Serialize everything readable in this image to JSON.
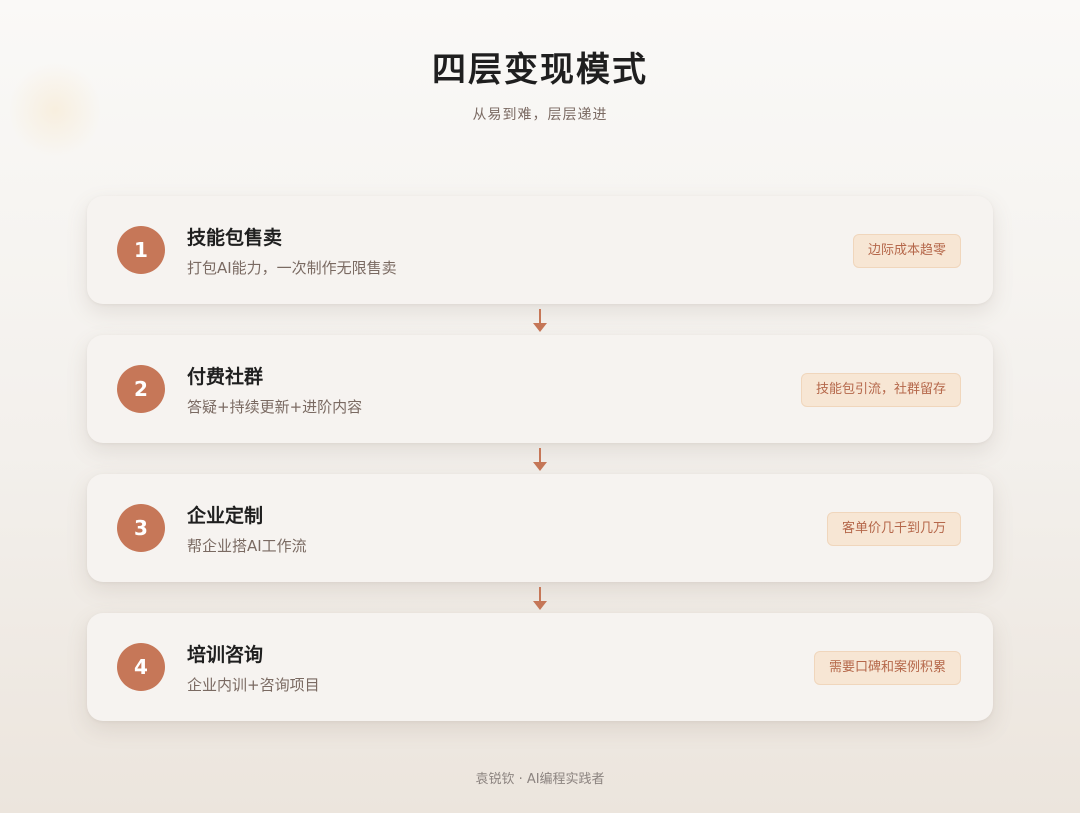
{
  "header": {
    "title": "四层变现模式",
    "subtitle": "从易到难，层层递进"
  },
  "steps": [
    {
      "num": "1",
      "name": "技能包售卖",
      "desc": "打包AI能力，一次制作无限售卖",
      "tag": "边际成本趋零"
    },
    {
      "num": "2",
      "name": "付费社群",
      "desc": "答疑+持续更新+进阶内容",
      "tag": "技能包引流，社群留存"
    },
    {
      "num": "3",
      "name": "企业定制",
      "desc": "帮企业搭AI工作流",
      "tag": "客单价几千到几万"
    },
    {
      "num": "4",
      "name": "培训咨询",
      "desc": "企业内训+咨询项目",
      "tag": "需要口碑和案例积累"
    }
  ],
  "footer": {
    "text": "袁锐钦 · AI编程实践者"
  },
  "colors": {
    "accent": "#c67758",
    "tag_bg": "#f7e6d4",
    "tag_text": "#b5674a"
  }
}
